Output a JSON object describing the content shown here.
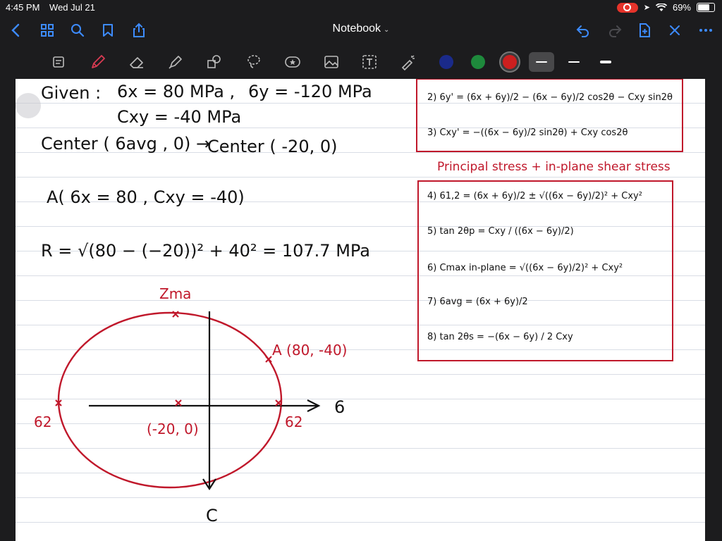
{
  "status": {
    "time": "4:45 PM",
    "date": "Wed Jul 21",
    "battery": "69%"
  },
  "nav": {
    "title": "Notebook",
    "title_chevron": "⌄"
  },
  "colors": {
    "ink_red": "#c0182b",
    "ink_black": "#111111",
    "swatch_navy": "#1a2a8a",
    "swatch_green": "#1e8a3c",
    "swatch_red": "#cc1f1f"
  },
  "notes": {
    "given_label": "Given :",
    "sigma_x": "6x = 80 MPa ,",
    "sigma_y": "6y = -120 MPa",
    "tau_xy": "Cxy = -40 MPa",
    "center_formula": "Center ( 6avg , 0) →",
    "center_value": "Center ( -20, 0)",
    "point_a": "A( 6x = 80 , Cxy = -40)",
    "radius": "R = √(80 − (−20))² + 40²  = 107.7 MPa",
    "circle": {
      "tau_max_label": "Zma",
      "point_a_label": "A (80, -40)",
      "sigma_axis_label": "6",
      "tau_axis_label": "C",
      "sigma2_left_label": "62",
      "sigma2_right_label": "62",
      "center_label": "(-20, 0)"
    }
  },
  "formulas_box1": {
    "f2": "2)  6y' = (6x + 6y)/2 − (6x − 6y)/2 cos2θ − Cxy sin2θ",
    "f3": "3)  Cxy' = −((6x − 6y)/2 sin2θ) + Cxy cos2θ"
  },
  "principal_heading": "Principal stress + in-plane shear stress",
  "formulas_box2": {
    "f4": "4)  61,2 = (6x + 6y)/2 ± √((6x − 6y)/2)² + Cxy²",
    "f5": "5)  tan 2θp = Cxy / ((6x − 6y)/2)",
    "f6": "6)  Cmax in-plane = √((6x − 6y)/2)² + Cxy²",
    "f7": "7)  6avg = (6x + 6y)/2",
    "f8": "8)  tan 2θs = −(6x − 6y) / 2 Cxy"
  }
}
